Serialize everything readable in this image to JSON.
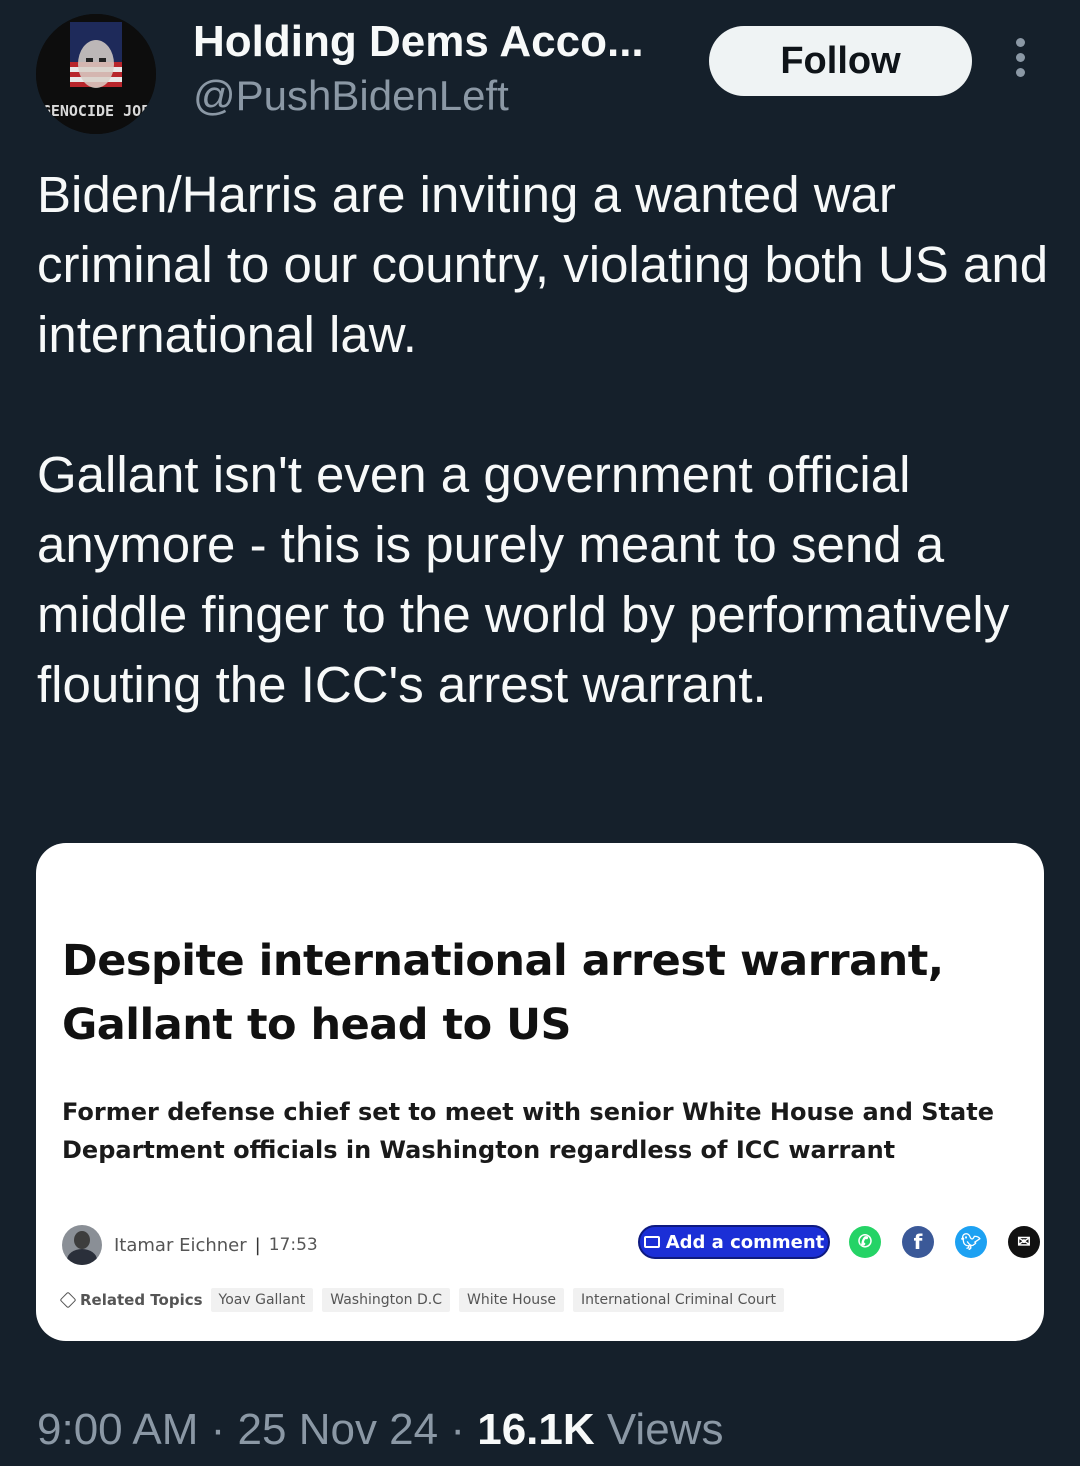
{
  "author": {
    "display_name": "Holding Dems Acco...",
    "handle": "@PushBidenLeft",
    "avatar_text": "GENOCIDE JOE"
  },
  "follow_label": "Follow",
  "tweet": {
    "paragraphs": [
      "Biden/Harris are inviting a wanted war criminal to our country, violating both US and international law.",
      "Gallant isn't even a government official anymore - this is purely meant to send a middle finger to the world by performatively flouting the ICC's arrest warrant."
    ]
  },
  "card": {
    "headline": "Despite international arrest warrant, Gallant to head to US",
    "subheadline": "Former defense chief set to meet with senior White House and State Department officials in Washington regardless of ICC warrant",
    "author": "Itamar Eichner",
    "separator": "|",
    "time": "17:53",
    "comment_button": "Add a comment",
    "share_icons": [
      "whatsapp-icon",
      "facebook-icon",
      "twitter-icon",
      "email-icon"
    ],
    "related_label": "Related Topics",
    "topics": [
      "Yoav Gallant",
      "Washington D.C",
      "White House",
      "International Criminal Court"
    ]
  },
  "meta": {
    "time": "9:00 AM",
    "sep1": " · ",
    "date": "25 Nov 24",
    "sep2": " · ",
    "views_count": "16.1K",
    "views_label": " Views"
  },
  "colors": {
    "background": "#15202b",
    "text_primary": "#f7f9f9",
    "text_secondary": "#8b98a5",
    "comment_button": "#1b2fd6"
  }
}
